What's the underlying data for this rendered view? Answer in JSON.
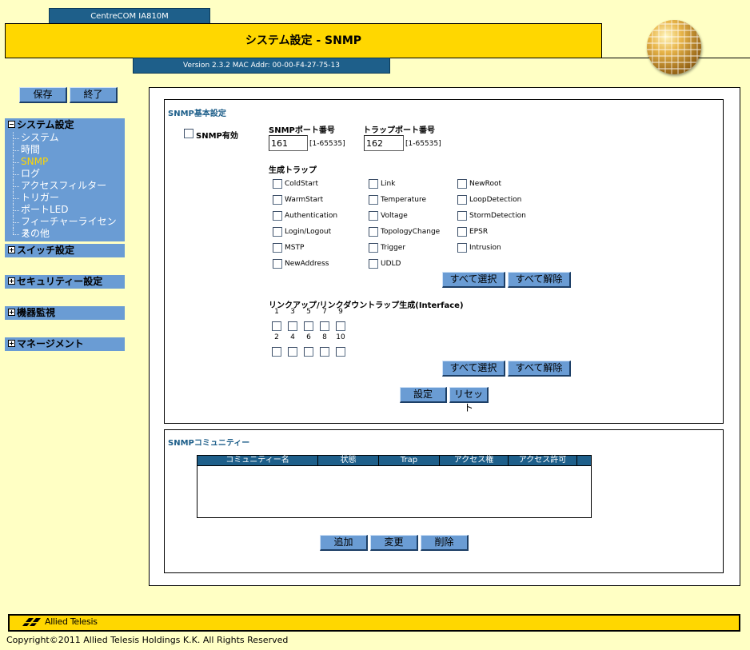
{
  "header": {
    "model": "CentreCOM IA810M",
    "title": "システム設定 - SNMP",
    "version": "Version 2.3.2 MAC Addr: 00-00-F4-27-75-13"
  },
  "nav": {
    "save_label": "保存",
    "exit_label": "終了",
    "sections": [
      {
        "label": "システム設定",
        "expanded": true,
        "items": [
          "システム",
          "時間",
          "SNMP",
          "ログ",
          "アクセスフィルター",
          "トリガー",
          "ポートLED",
          "フィーチャーライセンス",
          "その他"
        ],
        "active_index": 2
      },
      {
        "label": "スイッチ設定"
      },
      {
        "label": "セキュリティー設定"
      },
      {
        "label": "機器監視"
      },
      {
        "label": "マネージメント"
      }
    ]
  },
  "snmp_basic": {
    "title": "SNMP基本設定",
    "enable_label": "SNMP有効",
    "port_label": "SNMPポート番号",
    "port_value": "161",
    "port_range": "[1-65535]",
    "trap_port_label": "トラップポート番号",
    "trap_port_value": "162",
    "trap_port_range": "[1-65535]",
    "traps_label": "生成トラップ",
    "traps": [
      [
        "ColdStart",
        "Link",
        "NewRoot"
      ],
      [
        "WarmStart",
        "Temperature",
        "LoopDetection"
      ],
      [
        "Authentication",
        "Voltage",
        "StormDetection"
      ],
      [
        "Login/Logout",
        "TopologyChange",
        "EPSR"
      ],
      [
        "MSTP",
        "Trigger",
        "Intrusion"
      ],
      [
        "NewAddress",
        "UDLD",
        ""
      ]
    ],
    "select_all_label": "すべて選択",
    "clear_all_label": "すべて解除",
    "link_trap_label": "リンクアップ/リンクダウントラップ生成(Interface)",
    "ports_odd": [
      "1",
      "3",
      "5",
      "7",
      "9"
    ],
    "ports_even": [
      "2",
      "4",
      "6",
      "8",
      "10"
    ],
    "set_label": "設定",
    "reset_label": "リセット"
  },
  "community": {
    "title": "SNMPコミュニティー",
    "columns": [
      "コミュニティー名",
      "状態",
      "Trap",
      "アクセス権",
      "アクセス許可"
    ],
    "add_label": "追加",
    "change_label": "変更",
    "delete_label": "削除"
  },
  "footer": {
    "logo_text": "Allied Telesis",
    "copyright": "Copyright©2011 Allied Telesis Holdings K.K. All Rights Reserved"
  }
}
